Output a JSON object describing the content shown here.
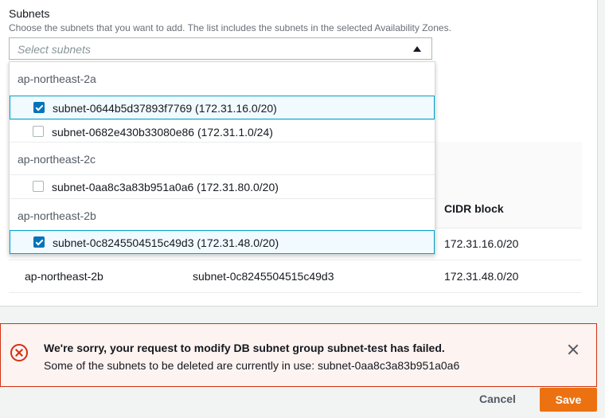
{
  "form": {
    "label": "Subnets",
    "description": "Choose the subnets that you want to add. The list includes the subnets in the selected Availability Zones.",
    "select_placeholder": "Select subnets"
  },
  "dropdown": {
    "groups": [
      {
        "name": "ap-northeast-2a",
        "options": [
          {
            "label": "subnet-0644b5d37893f7769 (172.31.16.0/20)",
            "checked": true
          },
          {
            "label": "subnet-0682e430b33080e86 (172.31.1.0/24)",
            "checked": false
          }
        ]
      },
      {
        "name": "ap-northeast-2c",
        "options": [
          {
            "label": "subnet-0aa8c3a83b951a0a6 (172.31.80.0/20)",
            "checked": false
          }
        ]
      },
      {
        "name": "ap-northeast-2b",
        "options": [
          {
            "label": "subnet-0c8245504515c49d3 (172.31.48.0/20)",
            "checked": true
          }
        ]
      }
    ]
  },
  "table": {
    "header_cidr": "CIDR block",
    "rows": [
      {
        "az": "",
        "subnet": "",
        "cidr": "172.31.16.0/20"
      },
      {
        "az": "ap-northeast-2b",
        "subnet": "subnet-0c8245504515c49d3",
        "cidr": "172.31.48.0/20"
      }
    ]
  },
  "flash": {
    "title": "We're sorry, your request to modify DB subnet group subnet-test has failed.",
    "message": "Some of the subnets to be deleted are currently in use: subnet-0aa8c3a83b951a0a6",
    "icon": "error-icon"
  },
  "actions": {
    "cancel_label": "Cancel",
    "save_label": "Save"
  },
  "colors": {
    "accent": "#ec7211",
    "error": "#d13212",
    "checkbox": "#0073bb"
  }
}
